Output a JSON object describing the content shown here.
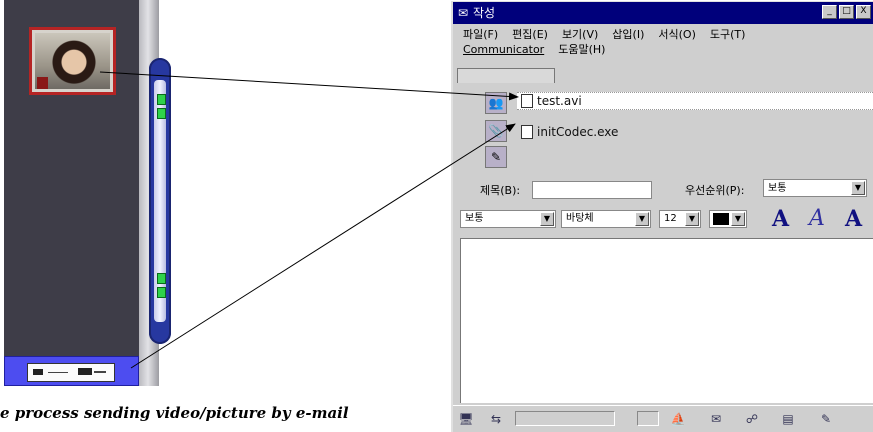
{
  "player": {
    "capture_label": "PHD ---- ------"
  },
  "mail_window": {
    "title": "작성",
    "title_icon": "app-icon",
    "window_buttons": [
      "_",
      "□",
      "X"
    ],
    "menu_row1": [
      "파일(F)",
      "편집(E)",
      "보기(V)",
      "삽입(I)",
      "서식(O)",
      "도구(T)"
    ],
    "menu_row2": [
      "Communicator",
      "도움말(H)"
    ],
    "attachments": [
      {
        "name": "test.avi"
      },
      {
        "name": "initCodec.exe"
      }
    ],
    "subject_label": "제목(B):",
    "subject_value": "",
    "priority_label": "우선순위(P):",
    "priority_value": "보통",
    "format": {
      "style": "보통",
      "font": "바탕체",
      "size": "12",
      "bold_a": "A",
      "italic_a": "A",
      "larger_a": "A"
    }
  },
  "caption": "e process sending video/picture by e-mail",
  "colors": {
    "title_bar": "#00007b",
    "player_bg": "#3e3d48",
    "slider": "#2738a0",
    "capture_btn": "#4d4df0",
    "thumb_border": "#b52424"
  }
}
